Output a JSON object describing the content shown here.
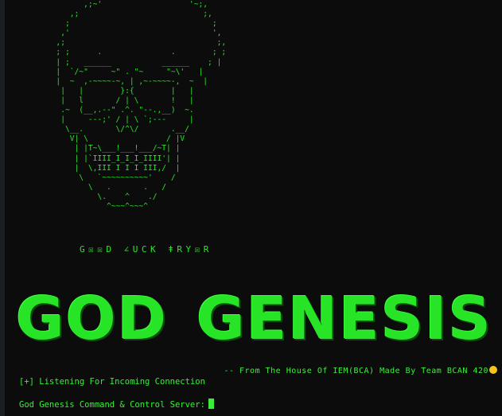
{
  "skull_art": [
    "             ,;~'                   '~;,",
    "          ,;                           ;,",
    "         ;                               ;",
    "        ,'                               ',",
    "       ,;                                 ;,",
    "       ; ;      .               .        ; ;",
    "       | ;   ______           ______    ; |",
    "       |  `/~\"     ~\" . \"~     \"~\\'   |",
    "       |  ~  ,-~~~~-~, | ,~-~~~~-,  ~  |",
    "        |   |        }:{        |   |",
    "        |   l       / | \\       !   |",
    "        .~  (__,.--\" .^. \"--.,__)  ~.",
    "        |     ---;' / | \\ `;---     |",
    "         \\__.       \\/^\\/       .__/",
    "          V| \\                 / |V",
    "           | |T~\\___!___!___/~T| |",
    "           | |`IIII_I_I_I_IIII'| |",
    "           |  \\,III I I I III,/  |",
    "            \\   `~~~~~~~~~~'    /",
    "              \\   .       .   /",
    "                \\.    ^    ./",
    "                  ^~~~^~~~^"
  ],
  "tagline": "G☒☒D  ∠UCK  ǂRY☒R",
  "banner": {
    "word1": "GOD",
    "word2": "GENESIS"
  },
  "credit": "-- From The House Of IEM(BCA) Made By Team BCAN 420",
  "status_line": "[+] Listening For Incoming Connection",
  "prompt_label": "God Genesis Command & Control Server:",
  "colors": {
    "text": "#2ef52e",
    "background": "#0c0c0c"
  }
}
